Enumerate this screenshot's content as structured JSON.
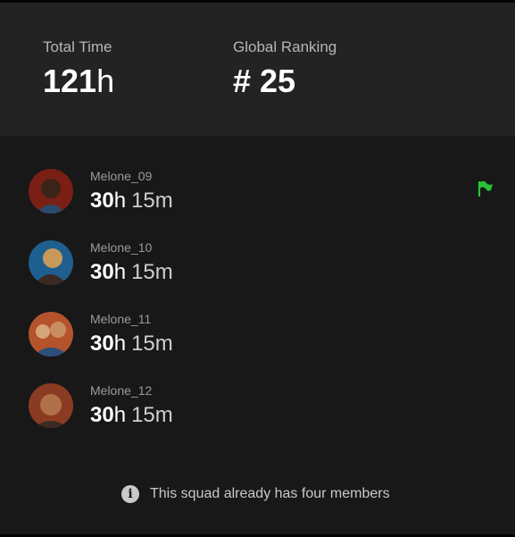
{
  "header": {
    "total_time": {
      "label": "Total Time",
      "value": "121",
      "unit": "h"
    },
    "global_ranking": {
      "label": "Global Ranking",
      "value": "# 25"
    }
  },
  "members": [
    {
      "name": "Melone_09",
      "hours": "30",
      "hours_unit": "h",
      "minutes": "15m",
      "flag": true,
      "avatar_colors": [
        "#7a1f14",
        "#2b4a6e"
      ]
    },
    {
      "name": "Melone_10",
      "hours": "30",
      "hours_unit": "h",
      "minutes": "15m",
      "flag": false,
      "avatar_colors": [
        "#1f5f8f",
        "#c79a5a"
      ]
    },
    {
      "name": "Melone_11",
      "hours": "30",
      "hours_unit": "h",
      "minutes": "15m",
      "flag": false,
      "avatar_colors": [
        "#b5532c",
        "#2c4f7a"
      ]
    },
    {
      "name": "Melone_12",
      "hours": "30",
      "hours_unit": "h",
      "minutes": "15m",
      "flag": false,
      "avatar_colors": [
        "#8c3b23",
        "#3a2a22"
      ]
    }
  ],
  "notice": {
    "icon": "info-icon",
    "text": "This squad already has four members"
  },
  "colors": {
    "flag": "#27c23a",
    "background": "#181818",
    "header_background": "#232323"
  }
}
